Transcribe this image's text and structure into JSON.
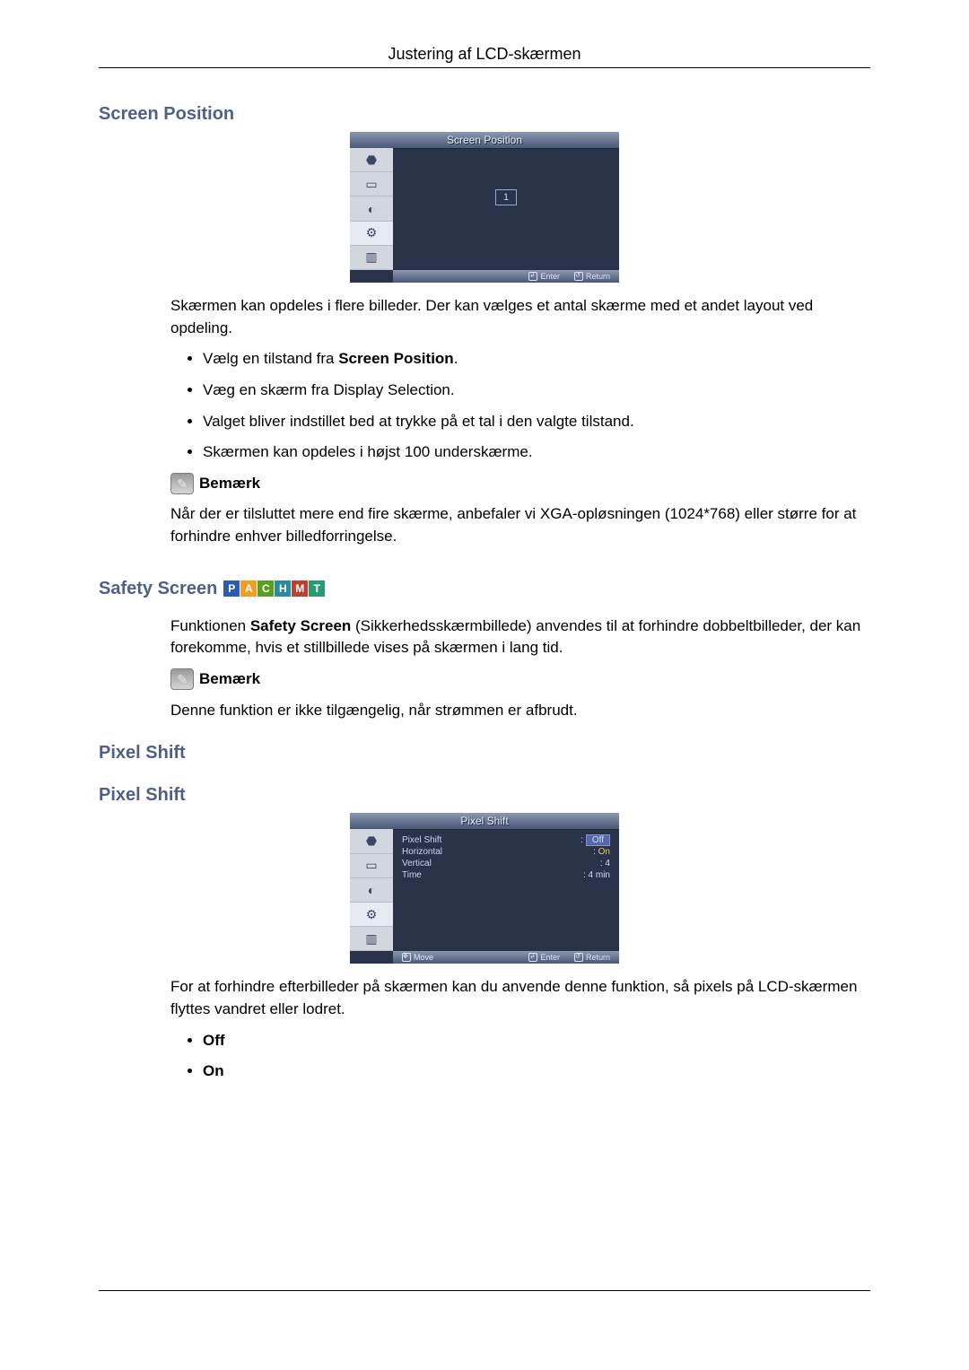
{
  "header": "Justering af LCD-skærmen",
  "sections": {
    "screenPosition": {
      "title": "Screen Position",
      "osd": {
        "title": "Screen Position",
        "value": "1",
        "footer": {
          "enter": "Enter",
          "return": "Return"
        }
      },
      "intro": "Skærmen kan opdeles i flere billeder. Der kan vælges et antal skærme med et andet layout ved opdeling.",
      "bullet1_prefix": "Vælg en tilstand fra ",
      "bullet1_bold": "Screen Position",
      "bullet1_suffix": ".",
      "bullet2": "Væg en skærm fra Display Selection.",
      "bullet3": "Valget bliver indstillet bed at trykke på et tal i den valgte tilstand.",
      "bullet4": "Skærmen kan opdeles i højst 100 underskærme.",
      "note_label": "Bemærk",
      "note_text": "Når der er tilsluttet mere end fire skærme, anbefaler vi XGA-opløsningen (1024*768) eller større for at forhindre enhver billedforringelse."
    },
    "safetyScreen": {
      "title": "Safety Screen",
      "badges": [
        "P",
        "A",
        "C",
        "H",
        "M",
        "T"
      ],
      "text_pre": "Funktionen ",
      "text_bold": "Safety Screen",
      "text_post": " (Sikkerhedsskærmbillede) anvendes til at forhindre dobbeltbilleder, der kan forekomme, hvis et stillbillede vises på skærmen i lang tid.",
      "note_label": "Bemærk",
      "note_text": "Denne funktion er ikke tilgængelig, når strømmen er afbrudt."
    },
    "pixelShift": {
      "title1": "Pixel Shift",
      "title2": "Pixel Shift",
      "osd": {
        "title": "Pixel Shift",
        "rows": [
          {
            "label": "Pixel Shift",
            "value": "Off",
            "sel": true
          },
          {
            "label": "Horizontal",
            "value": "On",
            "on": true
          },
          {
            "label": "Vertical",
            "value": ": 4"
          },
          {
            "label": "Time",
            "value": ": 4 min"
          }
        ],
        "footer": {
          "move": "Move",
          "enter": "Enter",
          "return": "Return"
        }
      },
      "text": "For at forhindre efterbilleder på skærmen kan du anvende denne funktion, så pixels på LCD-skærmen flyttes vandret eller lodret.",
      "opt_off": "Off",
      "opt_on": "On"
    }
  }
}
